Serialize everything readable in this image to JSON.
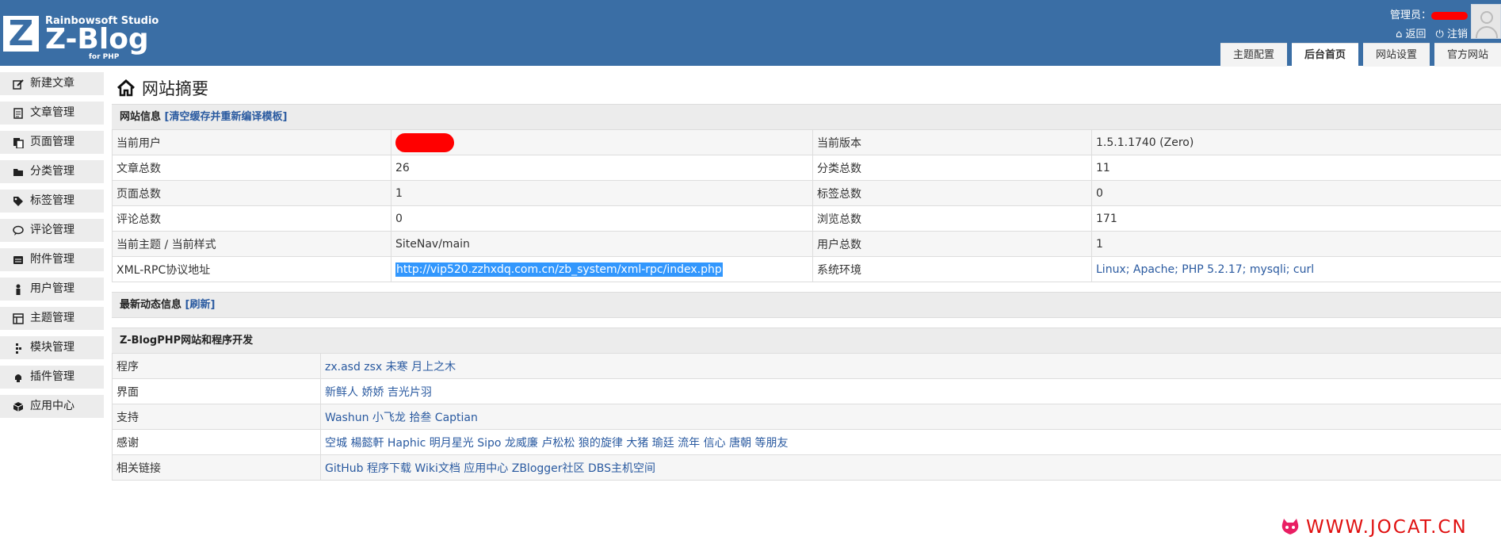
{
  "header": {
    "studio": "Rainbowsoft Studio",
    "brand": "Z-Blog",
    "sub": "for PHP",
    "logo_letter": "Z",
    "admin_label": "管理员：",
    "back_label": "返回",
    "logout_label": "注销",
    "tabs": [
      "主题配置",
      "后台首页",
      "网站设置",
      "官方网站"
    ]
  },
  "sidebar": {
    "items": [
      {
        "label": "新建文章",
        "icon": "edit-icon"
      },
      {
        "label": "文章管理",
        "icon": "articles-icon"
      },
      {
        "label": "页面管理",
        "icon": "pages-icon"
      },
      {
        "label": "分类管理",
        "icon": "folder-icon"
      },
      {
        "label": "标签管理",
        "icon": "tag-icon"
      },
      {
        "label": "评论管理",
        "icon": "comment-icon"
      },
      {
        "label": "附件管理",
        "icon": "attachment-icon"
      },
      {
        "label": "用户管理",
        "icon": "user-icon"
      },
      {
        "label": "主题管理",
        "icon": "theme-icon"
      },
      {
        "label": "模块管理",
        "icon": "module-icon"
      },
      {
        "label": "插件管理",
        "icon": "plugin-icon"
      },
      {
        "label": "应用中心",
        "icon": "app-center-icon"
      }
    ]
  },
  "main": {
    "title": "网站摘要",
    "site_info": {
      "label": "网站信息",
      "action": "[清空缓存并重新编译模板]",
      "rows": [
        {
          "k1": "当前用户",
          "v1": "",
          "k2": "当前版本",
          "v2": "1.5.1.1740 (Zero)"
        },
        {
          "k1": "文章总数",
          "v1": "26",
          "k2": "分类总数",
          "v2": "11"
        },
        {
          "k1": "页面总数",
          "v1": "1",
          "k2": "标签总数",
          "v2": "0"
        },
        {
          "k1": "评论总数",
          "v1": "0",
          "k2": "浏览总数",
          "v2": "171"
        },
        {
          "k1": "当前主题 / 当前样式",
          "v1": "SiteNav/main",
          "k2": "用户总数",
          "v2": "1"
        },
        {
          "k1": "XML-RPC协议地址",
          "v1": "http://vip520.zzhxdq.com.cn/zb_system/xml-rpc/index.php",
          "k2": "系统环境",
          "v2": "Linux; Apache; PHP 5.2.17; mysqli; curl"
        }
      ]
    },
    "news": {
      "label": "最新动态信息",
      "action": "[刷新]"
    },
    "dev": {
      "label": "Z-BlogPHP网站和程序开发",
      "rows": [
        {
          "k": "程序",
          "v": "zx.asd zsx 未寒 月上之木"
        },
        {
          "k": "界面",
          "v": "新鲜人 娇娇 吉光片羽"
        },
        {
          "k": "支持",
          "v": "Washun 小飞龙 拾叁 Captian"
        },
        {
          "k": "感谢",
          "v": "空城 楊懿軒 Haphic 明月星光 Sipo 龙威廉 卢松松 狼的旋律 大猪 瑜廷 流年 信心 唐朝 等朋友"
        },
        {
          "k": "相关链接",
          "v": "GitHub 程序下载  Wiki文档  应用中心  ZBlogger社区  DBS主机空间"
        }
      ]
    }
  },
  "watermark": "WWW.JOCAT.CN",
  "colors": {
    "header": "#3a6ea5",
    "link": "#2a5aa0",
    "watermark": "#e01010"
  }
}
